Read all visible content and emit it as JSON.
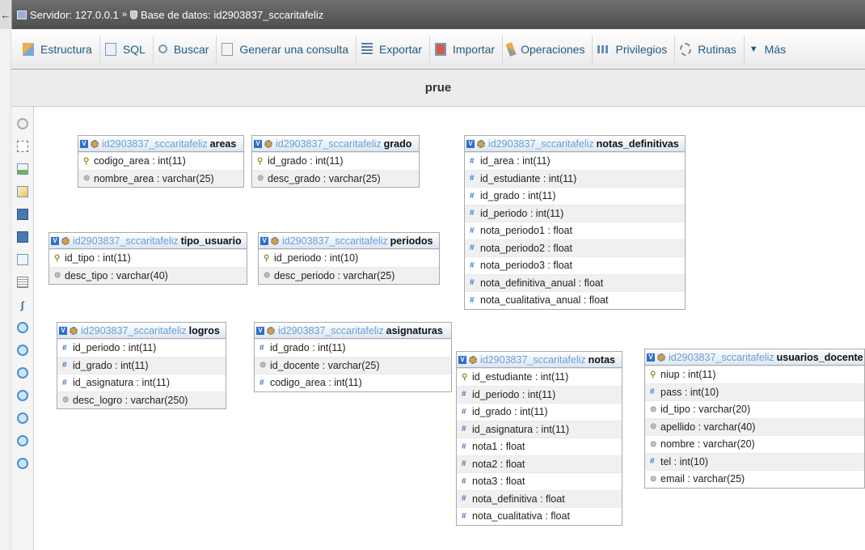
{
  "breadcrumb": {
    "back_symbol": "←",
    "arrow": "»",
    "server": "Servidor: 127.0.0.1",
    "database": "Base de datos: id2903837_sccaritafeliz"
  },
  "tabs": [
    {
      "label": "Estructura",
      "icon": "structure-icon"
    },
    {
      "label": "SQL",
      "icon": "sql-icon"
    },
    {
      "label": "Buscar",
      "icon": "search-icon"
    },
    {
      "label": "Generar una consulta",
      "icon": "query-icon"
    },
    {
      "label": "Exportar",
      "icon": "export-icon"
    },
    {
      "label": "Importar",
      "icon": "import-icon"
    },
    {
      "label": "Operaciones",
      "icon": "operations-icon"
    },
    {
      "label": "Privilegios",
      "icon": "privileges-icon"
    },
    {
      "label": "Rutinas",
      "icon": "routines-icon"
    },
    {
      "label": "Más",
      "icon": "chevron-down-icon",
      "caret": "▼"
    }
  ],
  "page": {
    "title": "prue"
  },
  "colors": {
    "header_bar": "#5a5a5a",
    "tab_text": "#235a81",
    "db_prefix": "#6aa0d2",
    "table_header": "#dbe6f3"
  },
  "db_prefix": "id2903837_sccaritafeliz",
  "tables": {
    "areas": {
      "name": "areas",
      "columns": [
        "codigo_area : int(11)",
        "nombre_area : varchar(25)"
      ],
      "keys": [
        "pk",
        "str"
      ]
    },
    "grado": {
      "name": "grado",
      "columns": [
        "id_grado : int(11)",
        "desc_grado : varchar(25)"
      ],
      "keys": [
        "pk",
        "str"
      ]
    },
    "notas_definitivas": {
      "name": "notas_definitivas",
      "columns": [
        "id_area : int(11)",
        "id_estudiante : int(11)",
        "id_grado : int(11)",
        "id_periodo : int(11)",
        "nota_periodo1 : float",
        "nota_periodo2 : float",
        "nota_periodo3 : float",
        "nota_definitiva_anual : float",
        "nota_cualitativa_anual : float"
      ],
      "keys": [
        "num",
        "num",
        "num",
        "num",
        "num",
        "num",
        "num",
        "num",
        "num"
      ]
    },
    "tipo_usuario": {
      "name": "tipo_usuario",
      "columns": [
        "id_tipo : int(11)",
        "desc_tipo : varchar(40)"
      ],
      "keys": [
        "pk",
        "str"
      ]
    },
    "periodos": {
      "name": "periodos",
      "columns": [
        "id_periodo : int(10)",
        "desc_periodo : varchar(25)"
      ],
      "keys": [
        "pk",
        "str"
      ]
    },
    "logros": {
      "name": "logros",
      "columns": [
        "id_periodo : int(11)",
        "id_grado : int(11)",
        "id_asignatura : int(11)",
        "desc_logro : varchar(250)"
      ],
      "keys": [
        "num",
        "num",
        "num",
        "str"
      ]
    },
    "asignaturas": {
      "name": "asignaturas",
      "columns": [
        "id_grado : int(11)",
        "id_docente : varchar(25)",
        "codigo_area : int(11)"
      ],
      "keys": [
        "num",
        "str",
        "num"
      ]
    },
    "notas": {
      "name": "notas",
      "columns": [
        "id_estudiante : int(11)",
        "id_periodo : int(11)",
        "id_grado : int(11)",
        "id_asignatura : int(11)",
        "nota1 : float",
        "nota2 : float",
        "nota3 : float",
        "nota_definitiva : float",
        "nota_cualitativa : float"
      ],
      "keys": [
        "pk",
        "num",
        "num",
        "num",
        "num",
        "num",
        "num",
        "num",
        "num"
      ]
    },
    "usuarios_docente": {
      "name": "usuarios_docente",
      "columns": [
        "niup : int(11)",
        "pass : int(10)",
        "id_tipo : varchar(20)",
        "apellido : varchar(40)",
        "nombre : varchar(20)",
        "tel : int(10)",
        "email : varchar(25)"
      ],
      "keys": [
        "pk",
        "num",
        "str",
        "str",
        "str",
        "num",
        "str"
      ]
    }
  },
  "key_glyphs": {
    "pk": "🔑",
    "num": "#",
    "str": "⊚"
  }
}
